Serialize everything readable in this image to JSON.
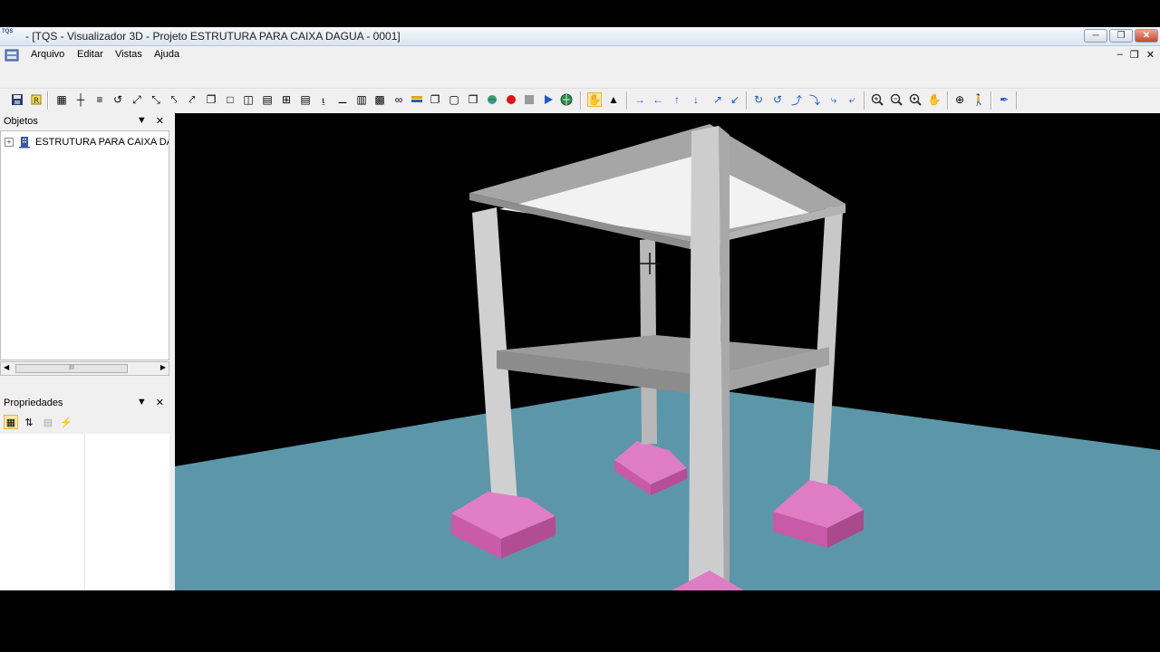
{
  "window": {
    "title": " - [TQS - Visualizador 3D - Projeto ESTRUTURA PARA CAIXA DAGUA - 0001]",
    "app_icon_text": "TQS"
  },
  "menu": {
    "items": [
      "Arquivo",
      "Editar",
      "Vistas",
      "Ajuda"
    ]
  },
  "objects_panel": {
    "title": "Objetos",
    "tree_root": "ESTRUTURA PARA CAIXA DAGUA",
    "scroll_grip": "III"
  },
  "properties_panel": {
    "title": "Propriedades"
  },
  "colors": {
    "ground": "#5b97a8",
    "concrete": "#d0d0d0",
    "footing": "#d96fbb",
    "background": "#000000"
  }
}
